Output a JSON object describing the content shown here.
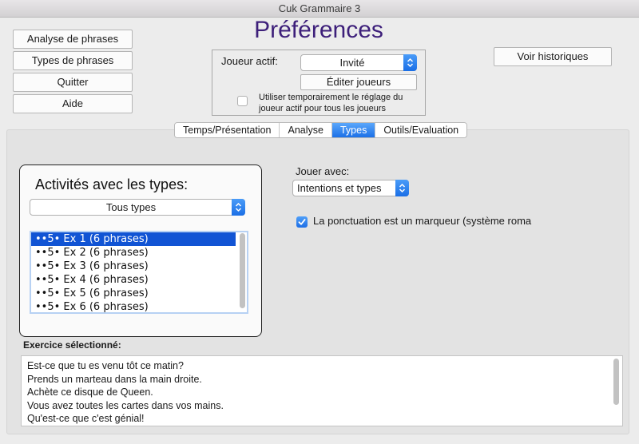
{
  "window": {
    "title": "Cuk Grammaire 3"
  },
  "nav_buttons": [
    {
      "label": "Analyse de phrases"
    },
    {
      "label": "Types de phrases"
    },
    {
      "label": "Quitter"
    },
    {
      "label": "Aide"
    }
  ],
  "page_title": "Préférences",
  "player": {
    "label": "Joueur actif:",
    "selected": "Invité",
    "edit_label": "Éditer joueurs",
    "temp_text": "Utiliser temporairement le réglage du joueur actif pour tous les joueurs",
    "temp_checked": false
  },
  "history_label": "Voir historiques",
  "tabs": [
    {
      "label": "Temps/Présentation"
    },
    {
      "label": "Analyse"
    },
    {
      "label": "Types"
    },
    {
      "label": "Outils/Evaluation"
    }
  ],
  "active_tab": "Types",
  "activities": {
    "title": "Activités avec les types:",
    "filter_selected": "Tous types",
    "items": [
      {
        "label": "••5• Ex 1 (6 phrases)"
      },
      {
        "label": "••5• Ex 2 (6 phrases)"
      },
      {
        "label": "••5• Ex 3 (6 phrases)"
      },
      {
        "label": "••5• Ex 4 (6 phrases)"
      },
      {
        "label": "••5• Ex 5 (6 phrases)"
      },
      {
        "label": "••5• Ex 6 (6 phrases)"
      }
    ],
    "selected_index": 0
  },
  "play_with": {
    "label": "Jouer avec:",
    "selected": "Intentions et types"
  },
  "punctuation": {
    "label": "La ponctuation est un marqueur (système roma",
    "checked": true
  },
  "selected_exercise": {
    "label": "Exercice sélectionné:",
    "lines": [
      "Est-ce que tu es venu tôt ce matin?",
      "Prends un marteau dans la main droite.",
      "Achète ce disque de Queen.",
      "Vous avez toutes les cartes dans vos mains.",
      "Qu'est-ce que c'est génial!"
    ]
  }
}
